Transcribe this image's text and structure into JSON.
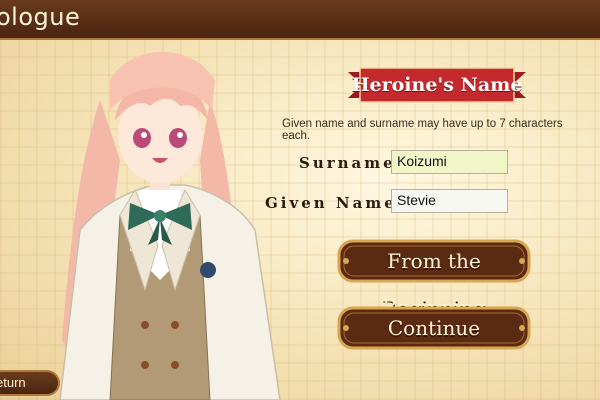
{
  "header": {
    "title": "ologue"
  },
  "name_panel": {
    "heading": "Heroine's Name",
    "hint": "Given name and surname may have up to 7 characters each.",
    "surname_label": "Surname",
    "surname_value": "Koizumi",
    "given_label": "Given Name",
    "given_value": "Stevie"
  },
  "buttons": {
    "from_beginning": "From the Beginning",
    "continue": "Continue"
  },
  "footer": {
    "return_label": "eturn"
  },
  "colors": {
    "header_brown": "#4a2410",
    "ribbon_red": "#c42a2d",
    "button_brown": "#5a2a12",
    "gold_trim": "#d8a650",
    "surname_field_bg": "#f1f6c8",
    "given_field_bg": "#f7f7f2"
  }
}
